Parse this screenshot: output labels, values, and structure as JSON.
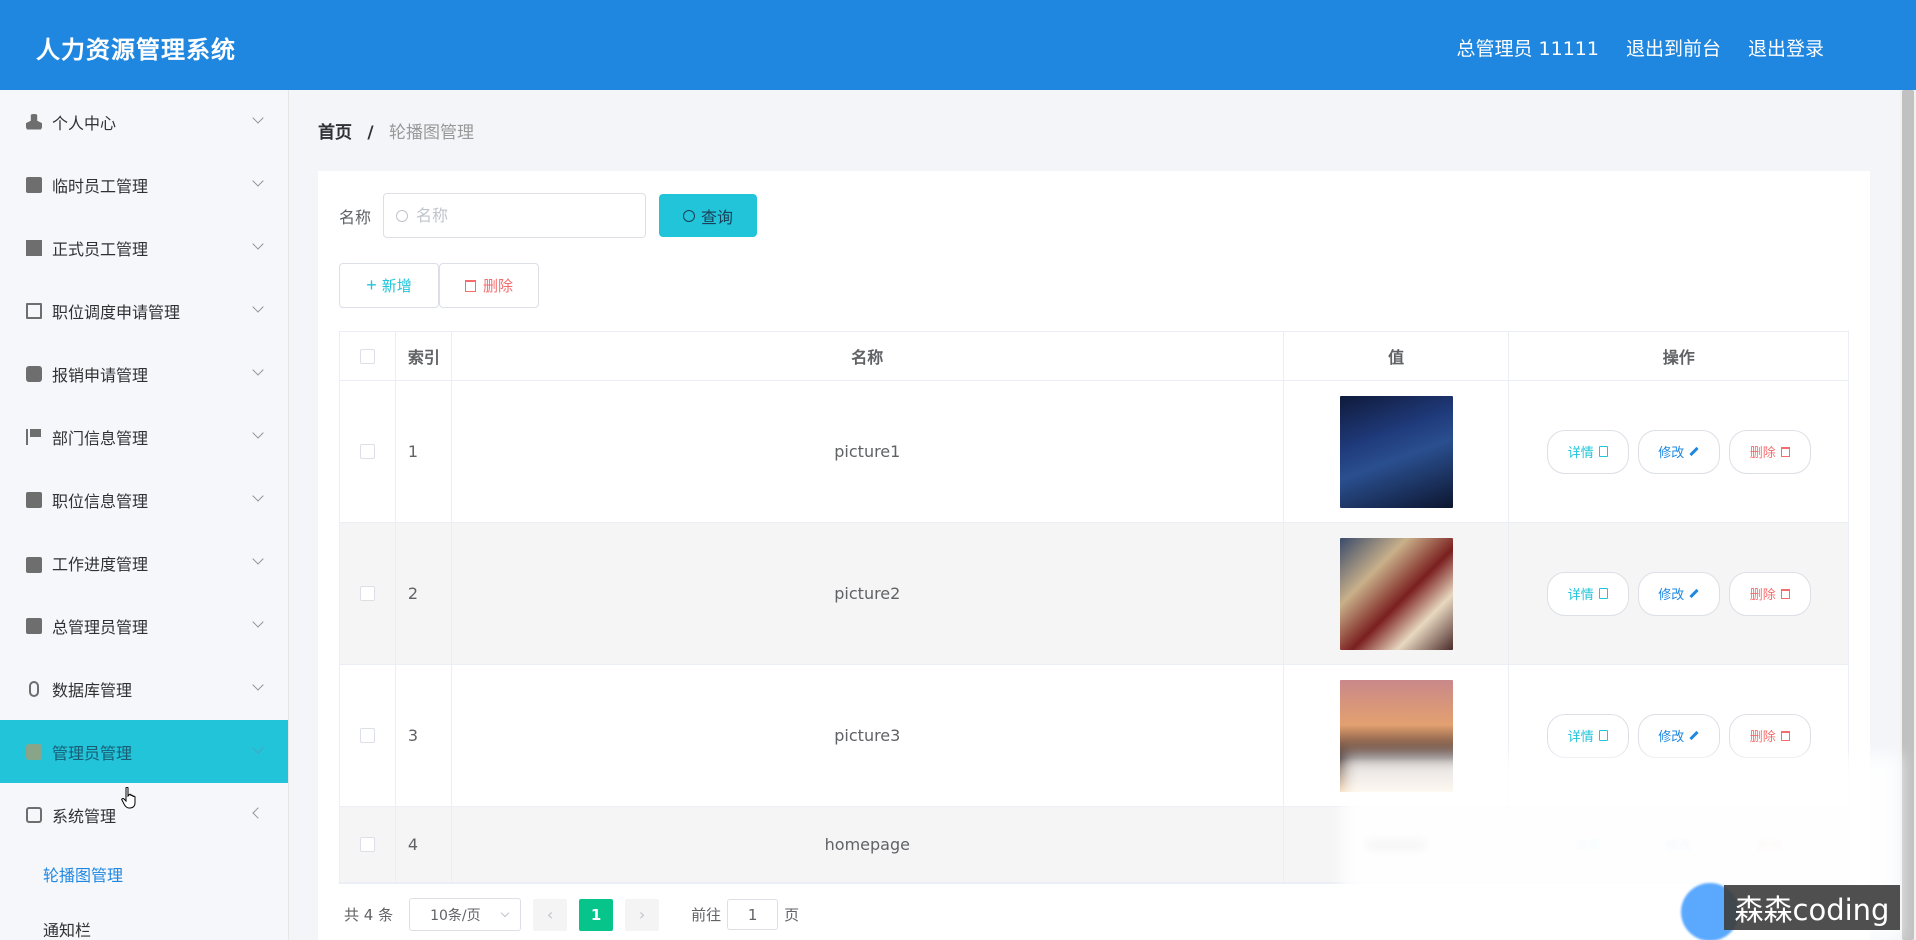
{
  "header": {
    "title": "人力资源管理系统",
    "user": "总管理员 11111",
    "exit_front": "退出到前台",
    "logout": "退出登录"
  },
  "sidebar": {
    "items": [
      {
        "label": "个人中心",
        "icon": "user-icon"
      },
      {
        "label": "临时员工管理",
        "icon": "clipboard-icon"
      },
      {
        "label": "正式员工管理",
        "icon": "books-icon"
      },
      {
        "label": "职位调度申请管理",
        "icon": "crop-icon"
      },
      {
        "label": "报销申请管理",
        "icon": "chat-icon"
      },
      {
        "label": "部门信息管理",
        "icon": "flag-icon"
      },
      {
        "label": "职位信息管理",
        "icon": "stamp-icon"
      },
      {
        "label": "工作进度管理",
        "icon": "briefcase-icon"
      },
      {
        "label": "总管理员管理",
        "icon": "notepad-icon"
      },
      {
        "label": "数据库管理",
        "icon": "microphone-icon"
      },
      {
        "label": "管理员管理",
        "icon": "admin-icon"
      },
      {
        "label": "系统管理",
        "icon": "message-icon"
      }
    ],
    "subitems": [
      {
        "label": "轮播图管理"
      },
      {
        "label": "通知栏"
      }
    ]
  },
  "breadcrumb": {
    "home": "首页",
    "separator": "/",
    "current": "轮播图管理"
  },
  "search": {
    "label": "名称",
    "placeholder": "名称",
    "button": "查询"
  },
  "actions": {
    "add": "新增",
    "delete": "删除"
  },
  "table": {
    "headers": [
      "索引",
      "名称",
      "值",
      "操作"
    ],
    "rows": [
      {
        "index": "1",
        "name": "picture1"
      },
      {
        "index": "2",
        "name": "picture2"
      },
      {
        "index": "3",
        "name": "picture3"
      },
      {
        "index": "4",
        "name": "homepage"
      }
    ],
    "ops": {
      "detail": "详情",
      "edit": "修改",
      "remove": "删除"
    }
  },
  "pagination": {
    "total": "共 4 条",
    "page_size": "10条/页",
    "current_page": "1",
    "goto_label": "前往",
    "goto_value": "1",
    "goto_suffix": "页"
  },
  "watermark": "森森coding",
  "colors": {
    "header": "#1f87e0",
    "accent": "#21c4d9",
    "active_page": "#07c48a",
    "danger": "#f56c6c"
  }
}
